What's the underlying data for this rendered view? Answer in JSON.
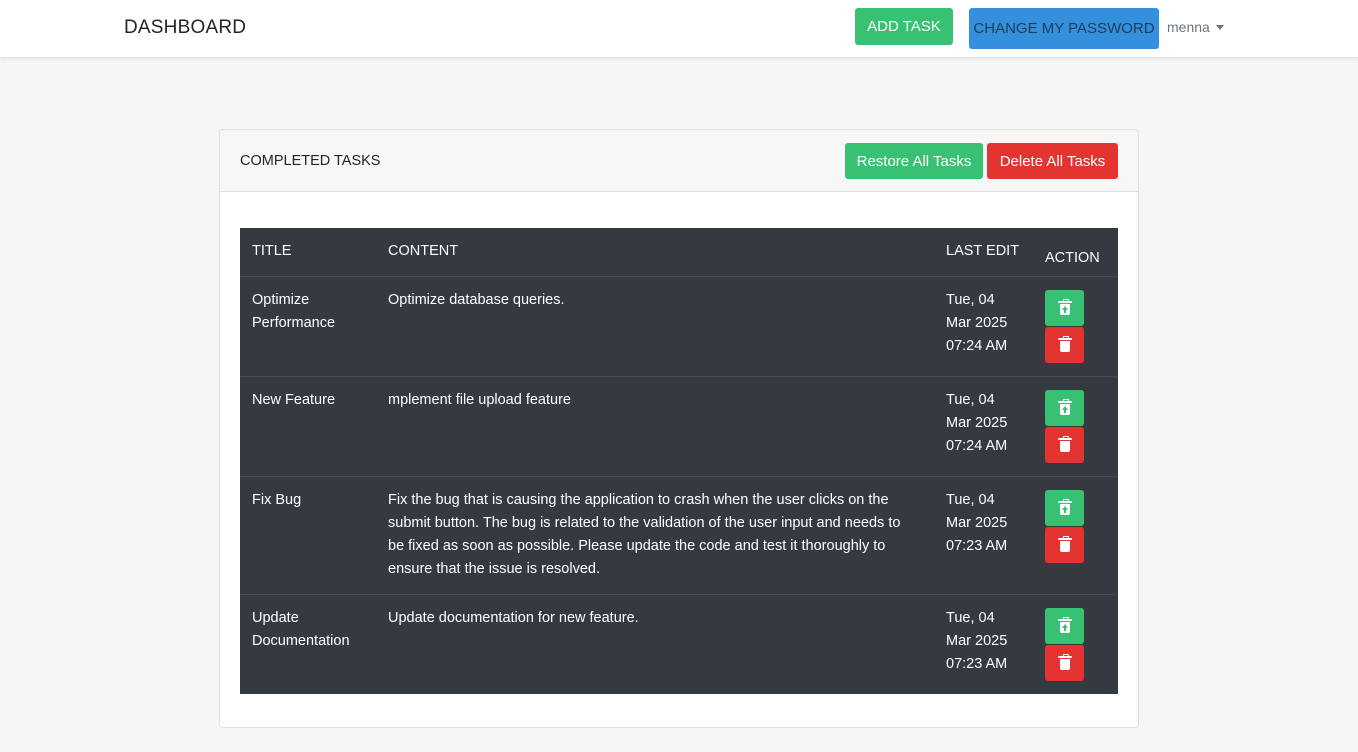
{
  "navbar": {
    "brand": "DASHBOARD",
    "add_task": "ADD TASK",
    "change_password": "CHANGE MY PASSWORD",
    "user": "menna"
  },
  "card": {
    "title": "COMPLETED TASKS",
    "restore_all": "Restore All Tasks",
    "delete_all": "Delete All Tasks"
  },
  "table": {
    "headers": [
      "TITLE",
      "CONTENT",
      "LAST EDIT",
      "ACTION"
    ],
    "rows": [
      {
        "title": "Optimize Performance",
        "content": "Optimize database queries.",
        "last_edit": "Tue, 04 Mar 2025 07:24 AM"
      },
      {
        "title": "New Feature",
        "content": "mplement file upload feature",
        "last_edit": "Tue, 04 Mar 2025 07:24 AM"
      },
      {
        "title": "Fix Bug",
        "content": "Fix the bug that is causing the application to crash when the user clicks on the submit button. The bug is related to the validation of the user input and needs to be fixed as soon as possible. Please update the code and test it thoroughly to ensure that the issue is resolved.",
        "last_edit": "Tue, 04 Mar 2025 07:23 AM"
      },
      {
        "title": "Update Documentation",
        "content": "Update documentation for new feature.",
        "last_edit": "Tue, 04 Mar 2025 07:23 AM"
      }
    ]
  },
  "icons": {
    "restore": "trash-restore-icon",
    "delete": "trash-icon"
  },
  "colors": {
    "success": "#38c172",
    "danger": "#e3342f",
    "primary": "#3490dc",
    "table_bg": "#343a40"
  }
}
